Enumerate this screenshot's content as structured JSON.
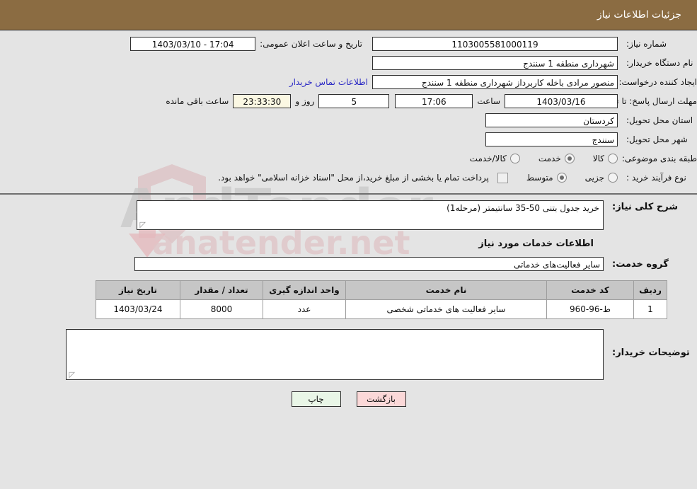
{
  "header": {
    "title": "جزئیات اطلاعات نیاز",
    "bar_color": "#8b6c42"
  },
  "top_form": {
    "need_number": {
      "label": "شماره نیاز:",
      "value": "1103005581000119"
    },
    "announce": {
      "label": "تاریخ و ساعت اعلان عمومی:",
      "value": "17:04 - 1403/03/10"
    },
    "buyer_org": {
      "label": "نام دستگاه خریدار:",
      "value": "شهرداری منطقه 1 سنندج"
    },
    "creator": {
      "label": "ایجاد کننده درخواست:",
      "value": "منصور مرادی باخله کاربرداز شهرداری منطقه 1 سنندج"
    },
    "contact_link": "اطلاعات تماس خریدار",
    "deadline": {
      "label": "مهلت ارسال پاسخ: تا تاریخ:",
      "date": "1403/03/16",
      "hour_label": "ساعت",
      "hour": "17:06",
      "days": "5",
      "days_suffix": "روز و",
      "countdown": "23:33:30",
      "countdown_suffix": "ساعت باقی مانده"
    },
    "province": {
      "label": "استان محل تحویل:",
      "value": "کردستان"
    },
    "city": {
      "label": "شهر محل تحویل:",
      "value": "سنندج"
    },
    "category": {
      "label": "طبقه بندی موضوعی:",
      "options": [
        {
          "label": "کالا",
          "selected": false
        },
        {
          "label": "خدمت",
          "selected": true
        },
        {
          "label": "کالا/خدمت",
          "selected": false
        }
      ]
    },
    "process": {
      "label": "نوع فرآیند خرید :",
      "options": [
        {
          "label": "جزیی",
          "selected": false
        },
        {
          "label": "متوسط",
          "selected": true
        }
      ],
      "checkbox_note": "پرداخت تمام یا بخشی از مبلغ خرید،از محل \"اسناد خزانه اسلامی\" خواهد بود.",
      "checkbox_checked": false
    }
  },
  "body": {
    "need_desc": {
      "label": "شرح کلی نیاز:",
      "value": "خرید جدول بتنی  50-35 سانتیمتر (مرحله1)"
    },
    "services_section_title": "اطلاعات خدمات مورد نیاز",
    "service_group": {
      "label": "گروه خدمت:",
      "value": "سایر فعالیت‌های خدماتی"
    },
    "buyer_notes": {
      "label": "توضیحات خریدار:",
      "value": ""
    }
  },
  "table": {
    "columns": [
      "ردیف",
      "کد خدمت",
      "نام خدمت",
      "واحد اندازه گیری",
      "تعداد / مقدار",
      "تاریخ نیاز"
    ],
    "rows": [
      {
        "radif": "1",
        "code": "ط-96-960",
        "name": "سایر فعالیت های خدماتی شخصی",
        "unit": "عدد",
        "qty": "8000",
        "date": "1403/03/24"
      }
    ]
  },
  "footer": {
    "print_label": "چاپ",
    "back_label": "بازگشت"
  }
}
